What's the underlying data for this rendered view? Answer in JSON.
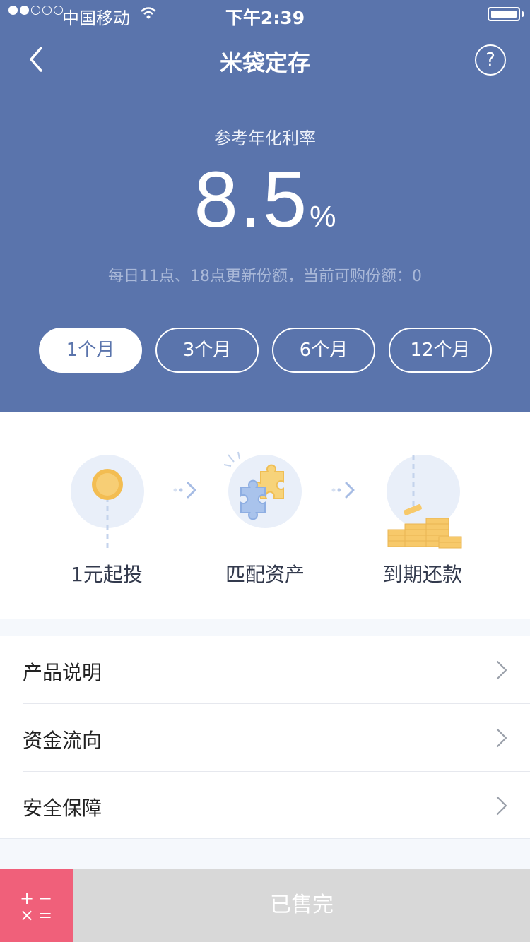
{
  "status_bar": {
    "carrier": "中国移动",
    "time": "下午2:39",
    "signal_icon": "signal-dots-icon",
    "wifi_icon": "wifi-icon",
    "battery_icon": "battery-icon"
  },
  "nav": {
    "title": "米袋定存",
    "back_icon": "chevron-left-icon",
    "help_label": "?"
  },
  "rate": {
    "label": "参考年化利率",
    "value": "8.5",
    "unit": "%",
    "note": "每日11点、18点更新份额，当前可购份额：0"
  },
  "terms": [
    {
      "label": "1个月",
      "active": true
    },
    {
      "label": "3个月",
      "active": false
    },
    {
      "label": "6个月",
      "active": false
    },
    {
      "label": "12个月",
      "active": false
    }
  ],
  "steps": [
    {
      "label": "1元起投",
      "icon": "coin-icon"
    },
    {
      "label": "匹配资产",
      "icon": "puzzle-icon"
    },
    {
      "label": "到期还款",
      "icon": "coin-stack-icon"
    }
  ],
  "menu": [
    {
      "label": "产品说明"
    },
    {
      "label": "资金流向"
    },
    {
      "label": "安全保障"
    }
  ],
  "bottom": {
    "calculator_symbols": [
      "+",
      "−",
      "×",
      "="
    ],
    "soldout_label": "已售完"
  },
  "colors": {
    "header_bg": "#5a74ac",
    "calculator_bg": "#f0607a",
    "soldout_bg": "#d8d8d8",
    "coin": "#f7c96a"
  }
}
